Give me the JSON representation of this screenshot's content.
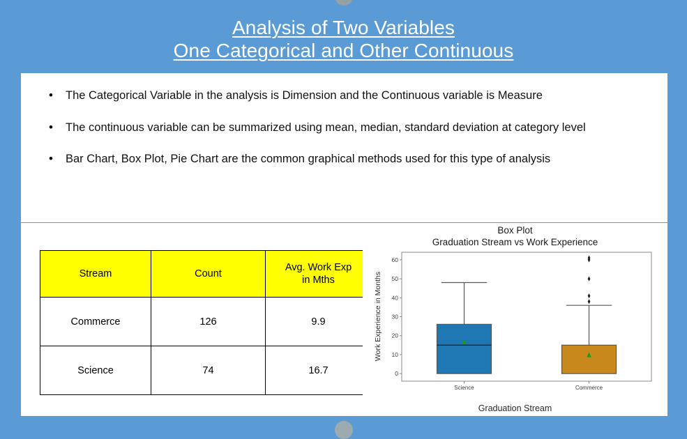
{
  "slide": {
    "title_line1": "Analysis of Two Variables",
    "title_line2": "One Categorical and Other Continuous",
    "background_color": "#5B9BD5",
    "card_color": "#FFFFFF",
    "divider_color": "#5B9BD5"
  },
  "bullets": [
    {
      "marker": "•",
      "text": "The Categorical Variable in the analysis is Dimension and the Continuous variable is Measure"
    },
    {
      "marker": "•",
      "text": "The continuous variable can be summarized using mean, median, standard deviation at category level"
    },
    {
      "marker": "•",
      "text": "Bar Chart, Box Plot, Pie Chart are the common graphical methods used for this type of analysis"
    }
  ],
  "table": {
    "header_background": "#FFFF00",
    "headers": [
      "Stream",
      "Count",
      "Avg. Work Exp in Mths"
    ],
    "headers_display": [
      {
        "line1": "Stream",
        "line2": ""
      },
      {
        "line1": "Count",
        "line2": ""
      },
      {
        "line1": "Avg. Work Exp",
        "line2": "in Mths"
      }
    ],
    "rows": [
      [
        "Commerce",
        "126",
        "9.9"
      ],
      [
        "Science",
        "74",
        "16.7"
      ]
    ]
  },
  "chart_data": {
    "type": "box",
    "title": "Box Plot",
    "subtitle": "Graduation Stream vs Work Experience",
    "xlabel": "Graduation Stream",
    "ylabel": "Work Experience in Months",
    "categories": [
      "Science",
      "Commerce"
    ],
    "ylim": [
      -4,
      64
    ],
    "yticks": [
      0,
      10,
      20,
      30,
      40,
      50,
      60
    ],
    "ytick_labels": [
      "0",
      "10",
      "20",
      "30",
      "40",
      "50",
      "60"
    ],
    "grid": false,
    "legend": "none",
    "mean_marker": "green-triangle",
    "mean_marker_color": "#1A9E1A",
    "boxes": [
      {
        "category": "Science",
        "color": "#1F77B4",
        "q1": 0,
        "median": 15,
        "q3": 26,
        "whisker_low": 0,
        "whisker_high": 48,
        "mean": 16.7,
        "outliers": []
      },
      {
        "category": "Commerce",
        "color": "#C8881C",
        "q1": 0,
        "median": 0,
        "q3": 15,
        "whisker_low": 0,
        "whisker_high": 36,
        "mean": 9.9,
        "outliers": [
          38,
          41,
          50,
          60,
          61
        ]
      }
    ]
  }
}
